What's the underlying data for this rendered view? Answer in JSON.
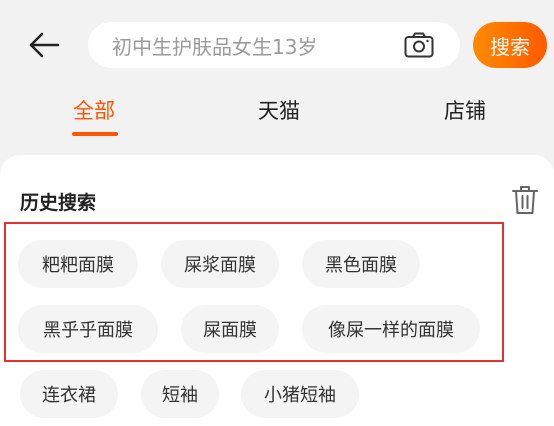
{
  "search": {
    "placeholder": "初中生护肤品女生13岁",
    "button_label": "搜索"
  },
  "tabs": [
    {
      "label": "全部",
      "active": true
    },
    {
      "label": "天猫",
      "active": false
    },
    {
      "label": "店铺",
      "active": false
    }
  ],
  "history": {
    "title": "历史搜索",
    "chips": [
      "粑粑面膜",
      "屎浆面膜",
      "黑色面膜",
      "黑乎乎面膜",
      "屎面膜",
      "像屎一样的面膜",
      "连衣裙",
      "短袖",
      "小猪短袖"
    ]
  },
  "colors": {
    "accent": "#ff5500",
    "highlight_border": "#e8312f"
  },
  "icons": {
    "back": "back-arrow-icon",
    "camera": "camera-icon",
    "trash": "trash-icon"
  }
}
